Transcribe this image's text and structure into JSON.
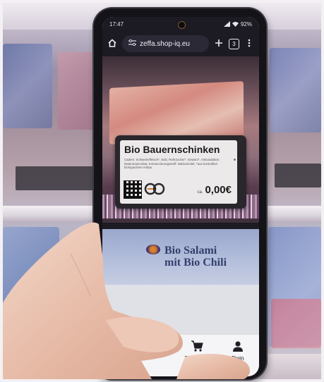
{
  "status_bar": {
    "time": "17:47",
    "battery": "92%"
  },
  "browser": {
    "url": "zeffa.shop-iq.eu",
    "tab_count": "3",
    "home_icon": "home-icon",
    "tune_icon": "site-settings-icon",
    "new_tab_icon": "plus-icon",
    "menu_icon": "kebab-menu-icon"
  },
  "price_tag": {
    "title": "Bio Bauernschinken",
    "description": "Cadem: Schweinefleisch*, Salz, Rohrzucker*, Gewürz*, Antioxidation: Natriumascorbat; Konservierungsstoff: Natriumnitrit. *aus kontrolliert biologischem Anbau",
    "price_prefix": "ca.",
    "price": "0,00€"
  },
  "product_card": {
    "line1": "Bio Salami",
    "line2": "mit Bio Chili"
  },
  "bottom_nav": {
    "items": [
      {
        "label": "Bestellen",
        "icon": "shopping-cart-icon"
      },
      {
        "label": "Dein Konto",
        "icon": "person-icon"
      }
    ]
  },
  "colors": {
    "browser_bar": "#1c1a22",
    "nav_bg": "#f5f5f7"
  }
}
